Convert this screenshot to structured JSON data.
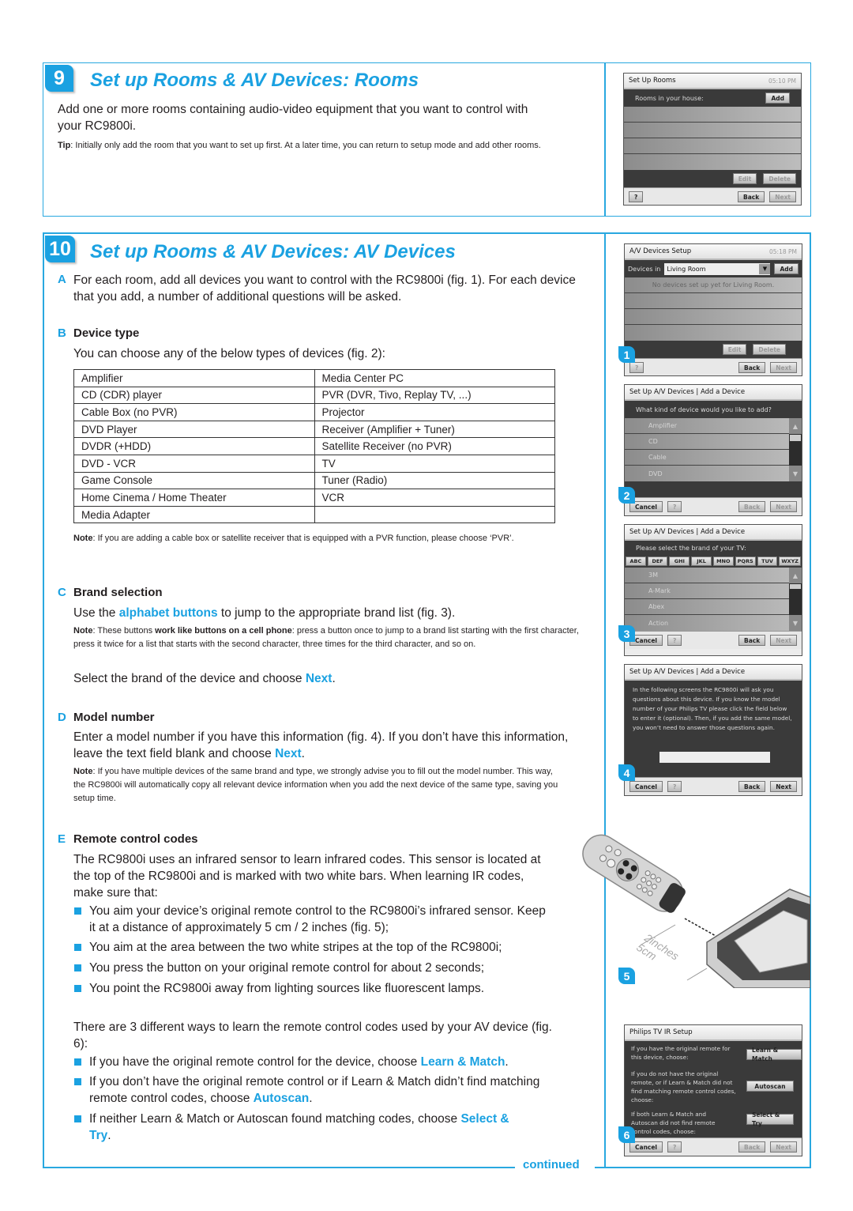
{
  "section9": {
    "number": "9",
    "title": "Set up Rooms & AV Devices: Rooms",
    "intro": "Add one or more rooms containing audio-video equipment that you want to control with your RC9800i.",
    "tip_label": "Tip",
    "tip_text": ": Initially only add the room that you want to set up first. At a later time, you can return to setup mode and add other rooms.",
    "screen": {
      "title": "Set Up Rooms",
      "time": "05:10 PM",
      "header_label": "Rooms in your house:",
      "add_button": "Add",
      "edit_button": "Edit",
      "delete_button": "Delete",
      "help_button": "?",
      "back_button": "Back",
      "next_button": "Next"
    }
  },
  "section10": {
    "number": "10",
    "title": "Set up Rooms & AV Devices: AV Devices",
    "A": {
      "letter": "A",
      "text": "For each room, add all devices you want to control with the RC9800i (fig. 1). For each device that you add, a number of additional questions will be asked."
    },
    "B": {
      "letter": "B",
      "heading": "Device type",
      "text": "You can choose any of the below types of devices (fig. 2):",
      "table": [
        [
          "Amplifier",
          "Media Center PC"
        ],
        [
          "CD (CDR) player",
          "PVR (DVR, Tivo, Replay TV, ...)"
        ],
        [
          "Cable Box (no PVR)",
          "Projector"
        ],
        [
          "DVD Player",
          "Receiver (Amplifier + Tuner)"
        ],
        [
          "DVDR (+HDD)",
          "Satellite Receiver (no PVR)"
        ],
        [
          "DVD - VCR",
          "TV"
        ],
        [
          "Game Console",
          "Tuner (Radio)"
        ],
        [
          "Home Cinema / Home Theater",
          "VCR"
        ],
        [
          "Media Adapter",
          ""
        ]
      ],
      "note_label": "Note",
      "note_text": ": If you are adding a cable box or satellite receiver that is equipped with a PVR function, please choose ‘PVR’."
    },
    "C": {
      "letter": "C",
      "heading": "Brand selection",
      "text_before": "Use the ",
      "text_link": "alphabet buttons",
      "text_after": " to jump to the appropriate brand list (fig. 3).",
      "note_label": "Note",
      "note_pre": ": These buttons ",
      "note_bold": "work like buttons on a cell phone",
      "note_post": ": press a button once to jump to a brand list starting with the first character, press it twice for a list that starts with the second character, three times for the third character, and so on.",
      "select_before": "Select the brand of the device and choose ",
      "select_link": "Next",
      "select_after": "."
    },
    "D": {
      "letter": "D",
      "heading": "Model number",
      "text_before": "Enter a model number if you have this information (fig. 4). If you don’t have this information, leave the text field blank and choose ",
      "text_link": "Next",
      "text_after": ".",
      "note_label": "Note",
      "note_text": ": If you have multiple devices of the same brand and type, we strongly advise you to fill out the model number. This way, the RC9800i will automatically copy all relevant device information when you add the next device of the same type, saving you setup time."
    },
    "E": {
      "letter": "E",
      "heading": "Remote control codes",
      "text": "The RC9800i uses an infrared sensor to learn infrared codes. This sensor is located at the top of the RC9800i and is marked with two white bars. When learning IR codes, make sure that:",
      "bullets": [
        "You aim your device’s original remote control to the RC9800i’s infrared sensor. Keep it at a distance of approximately 5 cm / 2 inches (fig. 5);",
        "You aim at the area between the two white stripes at the top of the RC9800i;",
        "You press the button on your original remote control for about 2 seconds;",
        "You point the RC9800i away from lighting sources like fluorescent lamps."
      ],
      "ways_text": "There are 3 different ways to learn the remote control codes used by your AV device (fig. 6):",
      "ways": [
        {
          "before": "If you have the original remote control for the device, choose ",
          "link": "Learn & Match",
          "after": "."
        },
        {
          "before": "If you don’t have the original remote control or if Learn & Match didn’t find matching remote control codes, choose ",
          "link": "Autoscan",
          "after": "."
        },
        {
          "before": "If neither Learn & Match or Autoscan found matching codes, choose ",
          "link": "Select & Try",
          "after": "."
        }
      ]
    },
    "continued": "continued",
    "figures": {
      "fig1": {
        "number": "1",
        "title": "A/V Devices Setup",
        "time": "05:18 PM",
        "devices_in_label": "Devices in",
        "room_value": "Living Room",
        "add_button": "Add",
        "empty_message": "No devices set up yet for Living Room.",
        "edit_button": "Edit",
        "delete_button": "Delete",
        "help_button": "?",
        "back_button": "Back",
        "next_button": "Next"
      },
      "fig2": {
        "number": "2",
        "title": "Set Up A/V Devices | Add a Device",
        "question": "What kind of device would you like to add?",
        "items": [
          "Amplifier",
          "CD",
          "Cable",
          "DVD"
        ],
        "cancel_button": "Cancel",
        "help_button": "?",
        "back_button": "Back",
        "next_button": "Next"
      },
      "fig3": {
        "number": "3",
        "title": "Set Up A/V Devices | Add a Device",
        "question": "Please select the brand of your TV:",
        "alphabet_buttons": [
          "ABC",
          "DEF",
          "GHI",
          "JKL",
          "MNO",
          "PQRS",
          "TUV",
          "WXYZ"
        ],
        "items": [
          "3M",
          "A-Mark",
          "Abex",
          "Action"
        ],
        "cancel_button": "Cancel",
        "help_button": "?",
        "back_button": "Back",
        "next_button": "Next"
      },
      "fig4": {
        "number": "4",
        "title": "Set Up A/V Devices | Add a Device",
        "message": "In the following screens the RC9800i will ask you questions about this device. If you know the model number of your Philips TV please click the field below to enter it (optional). Then, if you add the same model, you won’t need to answer those questions again.",
        "model_field_value": "",
        "cancel_button": "Cancel",
        "help_button": "?",
        "back_button": "Back",
        "next_button": "Next"
      },
      "fig5": {
        "number": "5",
        "distance_inches": "2inches",
        "distance_cm": "5cm"
      },
      "fig6": {
        "number": "6",
        "title": "Philips TV IR Setup",
        "options": [
          {
            "text": "If you have the original remote for this device, choose:",
            "button": "Learn & Match"
          },
          {
            "text": "If you do not have the original remote, or if Learn & Match did not find matching remote control codes, choose:",
            "button": "Autoscan"
          },
          {
            "text": "If both Learn & Match and Autoscan did not find remote control codes, choose:",
            "button": "Select & Try"
          }
        ],
        "cancel_button": "Cancel",
        "help_button": "?",
        "back_button": "Back",
        "next_button": "Next"
      }
    }
  }
}
